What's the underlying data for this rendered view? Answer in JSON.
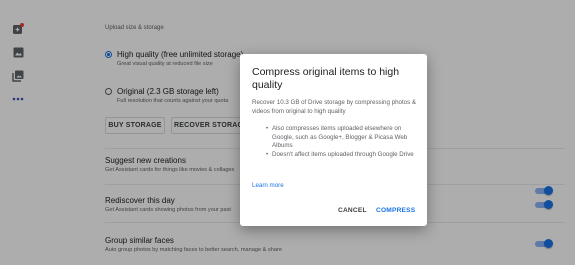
{
  "colors": {
    "accent": "#1a73e8",
    "toggle_track": "#8ab4f8",
    "badge": "#ea4335"
  },
  "rail": {
    "icons": [
      "assistant-icon",
      "photos-icon",
      "albums-icon",
      "more-horiz-icon"
    ]
  },
  "upload": {
    "section_title": "Upload size & storage",
    "high_quality_label": "High quality (free unlimited storage)",
    "high_quality_sub": "Great visual quality at reduced file size",
    "original_label": "Original (2.3 GB storage left)",
    "original_sub": "Full resolution that counts against your quota",
    "buy_storage": "BUY STORAGE",
    "recover_storage": "RECOVER STORAGE"
  },
  "settings": [
    {
      "title": "Suggest new creations",
      "desc": "Get Assistant cards for things like movies & collages",
      "enabled": true
    },
    {
      "title": "Rediscover this day",
      "desc": "Get Assistant cards showing photos from your past",
      "enabled": true
    },
    {
      "title": "Group similar faces",
      "desc": "Auto group photos by matching faces to better search, manage & share",
      "enabled": true
    }
  ],
  "dialog": {
    "title": "Compress original items to high quality",
    "body": "Recover 10.3 GB of Drive storage by compressing photos & videos from original to high quality",
    "bullets": [
      "Also compresses items uploaded elsewhere on Google, such as Google+, Blogger & Picasa Web Albums",
      "Doesn't affect items uploaded through Google Drive"
    ],
    "learn_more": "Learn more",
    "cancel": "CANCEL",
    "compress": "COMPRESS"
  }
}
